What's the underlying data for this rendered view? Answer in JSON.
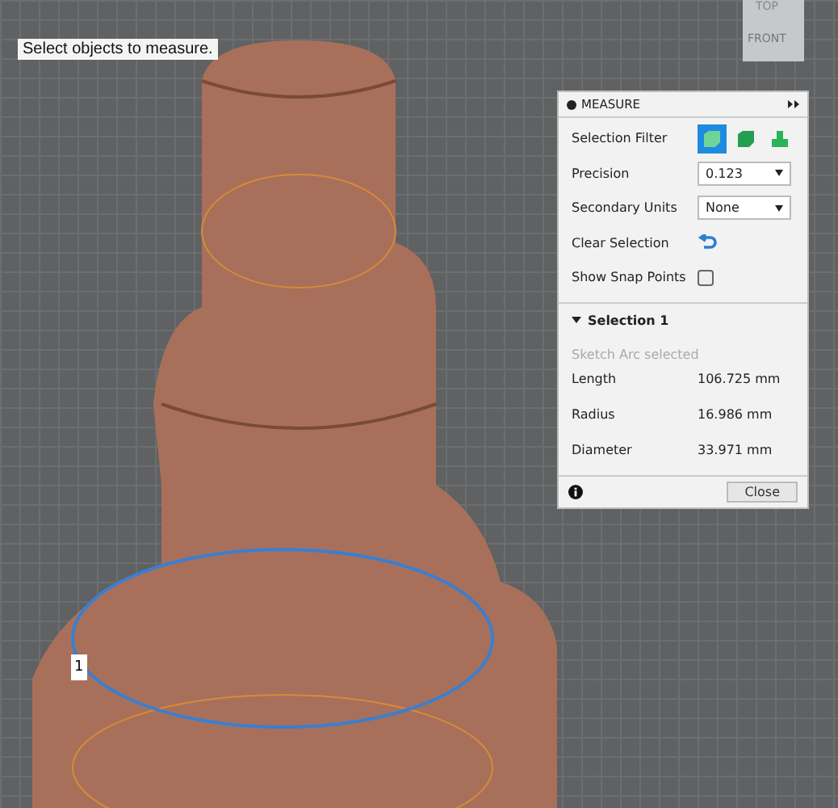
{
  "viewport": {
    "hint": "Select objects to measure.",
    "view_cube": {
      "top": "TOP",
      "front": "FRONT"
    },
    "marker": "1"
  },
  "measure": {
    "title": "MEASURE",
    "settings": [
      {
        "kind": "filter",
        "label": "Selection Filter",
        "filters": [
          {
            "selected": true
          },
          {
            "selected": false
          },
          {
            "selected": false
          }
        ]
      },
      {
        "kind": "dropdown",
        "label": "Precision",
        "value": "0.123"
      },
      {
        "kind": "dropdown",
        "label": "Secondary Units",
        "value": "None"
      },
      {
        "kind": "action",
        "label": "Clear Selection"
      },
      {
        "kind": "checkbox",
        "label": "Show Snap Points",
        "checked": false
      }
    ],
    "selection": {
      "title": "Selection 1",
      "expanded": true,
      "note": "Sketch Arc selected",
      "results": [
        {
          "label": "Length",
          "value": "106.725 mm"
        },
        {
          "label": "Radius",
          "value": "16.986 mm"
        },
        {
          "label": "Diameter",
          "value": "33.971 mm"
        }
      ]
    },
    "close_button": "Close"
  }
}
